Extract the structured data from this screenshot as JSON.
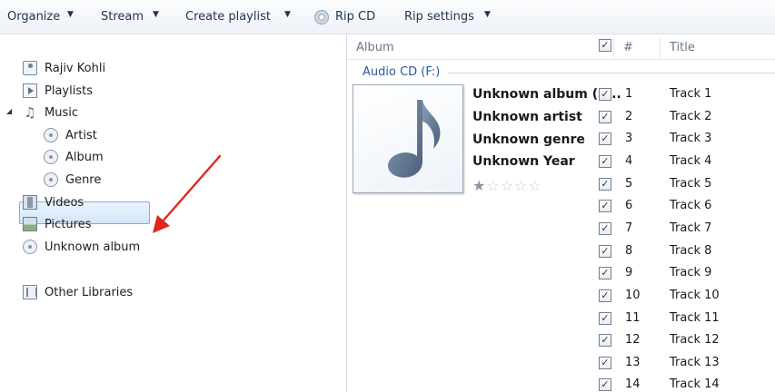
{
  "toolbar": {
    "organize": "Organize",
    "stream": "Stream",
    "create_playlist": "Create playlist",
    "rip_cd": "Rip CD",
    "rip_settings": "Rip settings",
    "dropdown_glyph": "▼"
  },
  "nav": {
    "user": "Rajiv Kohli",
    "playlists": "Playlists",
    "music": "Music",
    "artist": "Artist",
    "album": "Album",
    "genre": "Genre",
    "videos": "Videos",
    "pictures": "Pictures",
    "unknown_album": "Unknown album",
    "other_libraries": "Other Libraries",
    "expand_glyph": "◢"
  },
  "columns": {
    "album": "Album",
    "num": "#",
    "title": "Title"
  },
  "cd_group": "Audio CD (F:)",
  "album_info": {
    "album": "Unknown album (1...",
    "artist": "Unknown artist",
    "genre": "Unknown genre",
    "year": "Unknown Year",
    "rating_stars": 1,
    "rating_max": 5
  },
  "check_glyph": "✓",
  "tracks": [
    {
      "num": "1",
      "title": "Track 1"
    },
    {
      "num": "2",
      "title": "Track 2"
    },
    {
      "num": "3",
      "title": "Track 3"
    },
    {
      "num": "4",
      "title": "Track 4"
    },
    {
      "num": "5",
      "title": "Track 5"
    },
    {
      "num": "6",
      "title": "Track 6"
    },
    {
      "num": "7",
      "title": "Track 7"
    },
    {
      "num": "8",
      "title": "Track 8"
    },
    {
      "num": "9",
      "title": "Track 9"
    },
    {
      "num": "10",
      "title": "Track 10"
    },
    {
      "num": "11",
      "title": "Track 11"
    },
    {
      "num": "12",
      "title": "Track 12"
    },
    {
      "num": "13",
      "title": "Track 13"
    },
    {
      "num": "14",
      "title": "Track 14"
    }
  ],
  "colors": {
    "annotation_arrow": "#e0261f",
    "selection": "#d4e6fa",
    "group_header": "#2a5a9a"
  }
}
